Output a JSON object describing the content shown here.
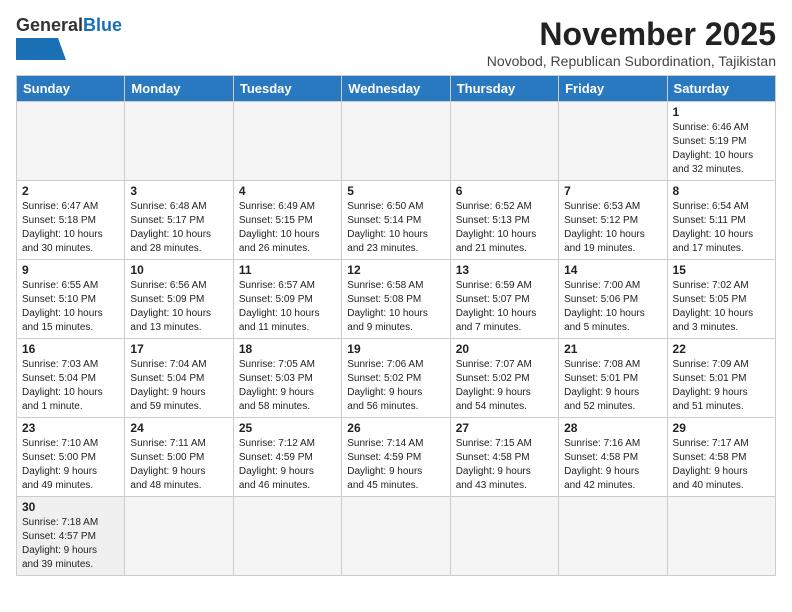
{
  "header": {
    "logo_general": "General",
    "logo_blue": "Blue",
    "month_year": "November 2025",
    "location": "Novobod, Republican Subordination, Tajikistan"
  },
  "weekdays": [
    "Sunday",
    "Monday",
    "Tuesday",
    "Wednesday",
    "Thursday",
    "Friday",
    "Saturday"
  ],
  "weeks": [
    [
      {
        "day": "",
        "info": ""
      },
      {
        "day": "",
        "info": ""
      },
      {
        "day": "",
        "info": ""
      },
      {
        "day": "",
        "info": ""
      },
      {
        "day": "",
        "info": ""
      },
      {
        "day": "",
        "info": ""
      },
      {
        "day": "1",
        "info": "Sunrise: 6:46 AM\nSunset: 5:19 PM\nDaylight: 10 hours\nand 32 minutes."
      }
    ],
    [
      {
        "day": "2",
        "info": "Sunrise: 6:47 AM\nSunset: 5:18 PM\nDaylight: 10 hours\nand 30 minutes."
      },
      {
        "day": "3",
        "info": "Sunrise: 6:48 AM\nSunset: 5:17 PM\nDaylight: 10 hours\nand 28 minutes."
      },
      {
        "day": "4",
        "info": "Sunrise: 6:49 AM\nSunset: 5:15 PM\nDaylight: 10 hours\nand 26 minutes."
      },
      {
        "day": "5",
        "info": "Sunrise: 6:50 AM\nSunset: 5:14 PM\nDaylight: 10 hours\nand 23 minutes."
      },
      {
        "day": "6",
        "info": "Sunrise: 6:52 AM\nSunset: 5:13 PM\nDaylight: 10 hours\nand 21 minutes."
      },
      {
        "day": "7",
        "info": "Sunrise: 6:53 AM\nSunset: 5:12 PM\nDaylight: 10 hours\nand 19 minutes."
      },
      {
        "day": "8",
        "info": "Sunrise: 6:54 AM\nSunset: 5:11 PM\nDaylight: 10 hours\nand 17 minutes."
      }
    ],
    [
      {
        "day": "9",
        "info": "Sunrise: 6:55 AM\nSunset: 5:10 PM\nDaylight: 10 hours\nand 15 minutes."
      },
      {
        "day": "10",
        "info": "Sunrise: 6:56 AM\nSunset: 5:09 PM\nDaylight: 10 hours\nand 13 minutes."
      },
      {
        "day": "11",
        "info": "Sunrise: 6:57 AM\nSunset: 5:09 PM\nDaylight: 10 hours\nand 11 minutes."
      },
      {
        "day": "12",
        "info": "Sunrise: 6:58 AM\nSunset: 5:08 PM\nDaylight: 10 hours\nand 9 minutes."
      },
      {
        "day": "13",
        "info": "Sunrise: 6:59 AM\nSunset: 5:07 PM\nDaylight: 10 hours\nand 7 minutes."
      },
      {
        "day": "14",
        "info": "Sunrise: 7:00 AM\nSunset: 5:06 PM\nDaylight: 10 hours\nand 5 minutes."
      },
      {
        "day": "15",
        "info": "Sunrise: 7:02 AM\nSunset: 5:05 PM\nDaylight: 10 hours\nand 3 minutes."
      }
    ],
    [
      {
        "day": "16",
        "info": "Sunrise: 7:03 AM\nSunset: 5:04 PM\nDaylight: 10 hours\nand 1 minute."
      },
      {
        "day": "17",
        "info": "Sunrise: 7:04 AM\nSunset: 5:04 PM\nDaylight: 9 hours\nand 59 minutes."
      },
      {
        "day": "18",
        "info": "Sunrise: 7:05 AM\nSunset: 5:03 PM\nDaylight: 9 hours\nand 58 minutes."
      },
      {
        "day": "19",
        "info": "Sunrise: 7:06 AM\nSunset: 5:02 PM\nDaylight: 9 hours\nand 56 minutes."
      },
      {
        "day": "20",
        "info": "Sunrise: 7:07 AM\nSunset: 5:02 PM\nDaylight: 9 hours\nand 54 minutes."
      },
      {
        "day": "21",
        "info": "Sunrise: 7:08 AM\nSunset: 5:01 PM\nDaylight: 9 hours\nand 52 minutes."
      },
      {
        "day": "22",
        "info": "Sunrise: 7:09 AM\nSunset: 5:01 PM\nDaylight: 9 hours\nand 51 minutes."
      }
    ],
    [
      {
        "day": "23",
        "info": "Sunrise: 7:10 AM\nSunset: 5:00 PM\nDaylight: 9 hours\nand 49 minutes."
      },
      {
        "day": "24",
        "info": "Sunrise: 7:11 AM\nSunset: 5:00 PM\nDaylight: 9 hours\nand 48 minutes."
      },
      {
        "day": "25",
        "info": "Sunrise: 7:12 AM\nSunset: 4:59 PM\nDaylight: 9 hours\nand 46 minutes."
      },
      {
        "day": "26",
        "info": "Sunrise: 7:14 AM\nSunset: 4:59 PM\nDaylight: 9 hours\nand 45 minutes."
      },
      {
        "day": "27",
        "info": "Sunrise: 7:15 AM\nSunset: 4:58 PM\nDaylight: 9 hours\nand 43 minutes."
      },
      {
        "day": "28",
        "info": "Sunrise: 7:16 AM\nSunset: 4:58 PM\nDaylight: 9 hours\nand 42 minutes."
      },
      {
        "day": "29",
        "info": "Sunrise: 7:17 AM\nSunset: 4:58 PM\nDaylight: 9 hours\nand 40 minutes."
      }
    ],
    [
      {
        "day": "30",
        "info": "Sunrise: 7:18 AM\nSunset: 4:57 PM\nDaylight: 9 hours\nand 39 minutes."
      },
      {
        "day": "",
        "info": ""
      },
      {
        "day": "",
        "info": ""
      },
      {
        "day": "",
        "info": ""
      },
      {
        "day": "",
        "info": ""
      },
      {
        "day": "",
        "info": ""
      },
      {
        "day": "",
        "info": ""
      }
    ]
  ]
}
